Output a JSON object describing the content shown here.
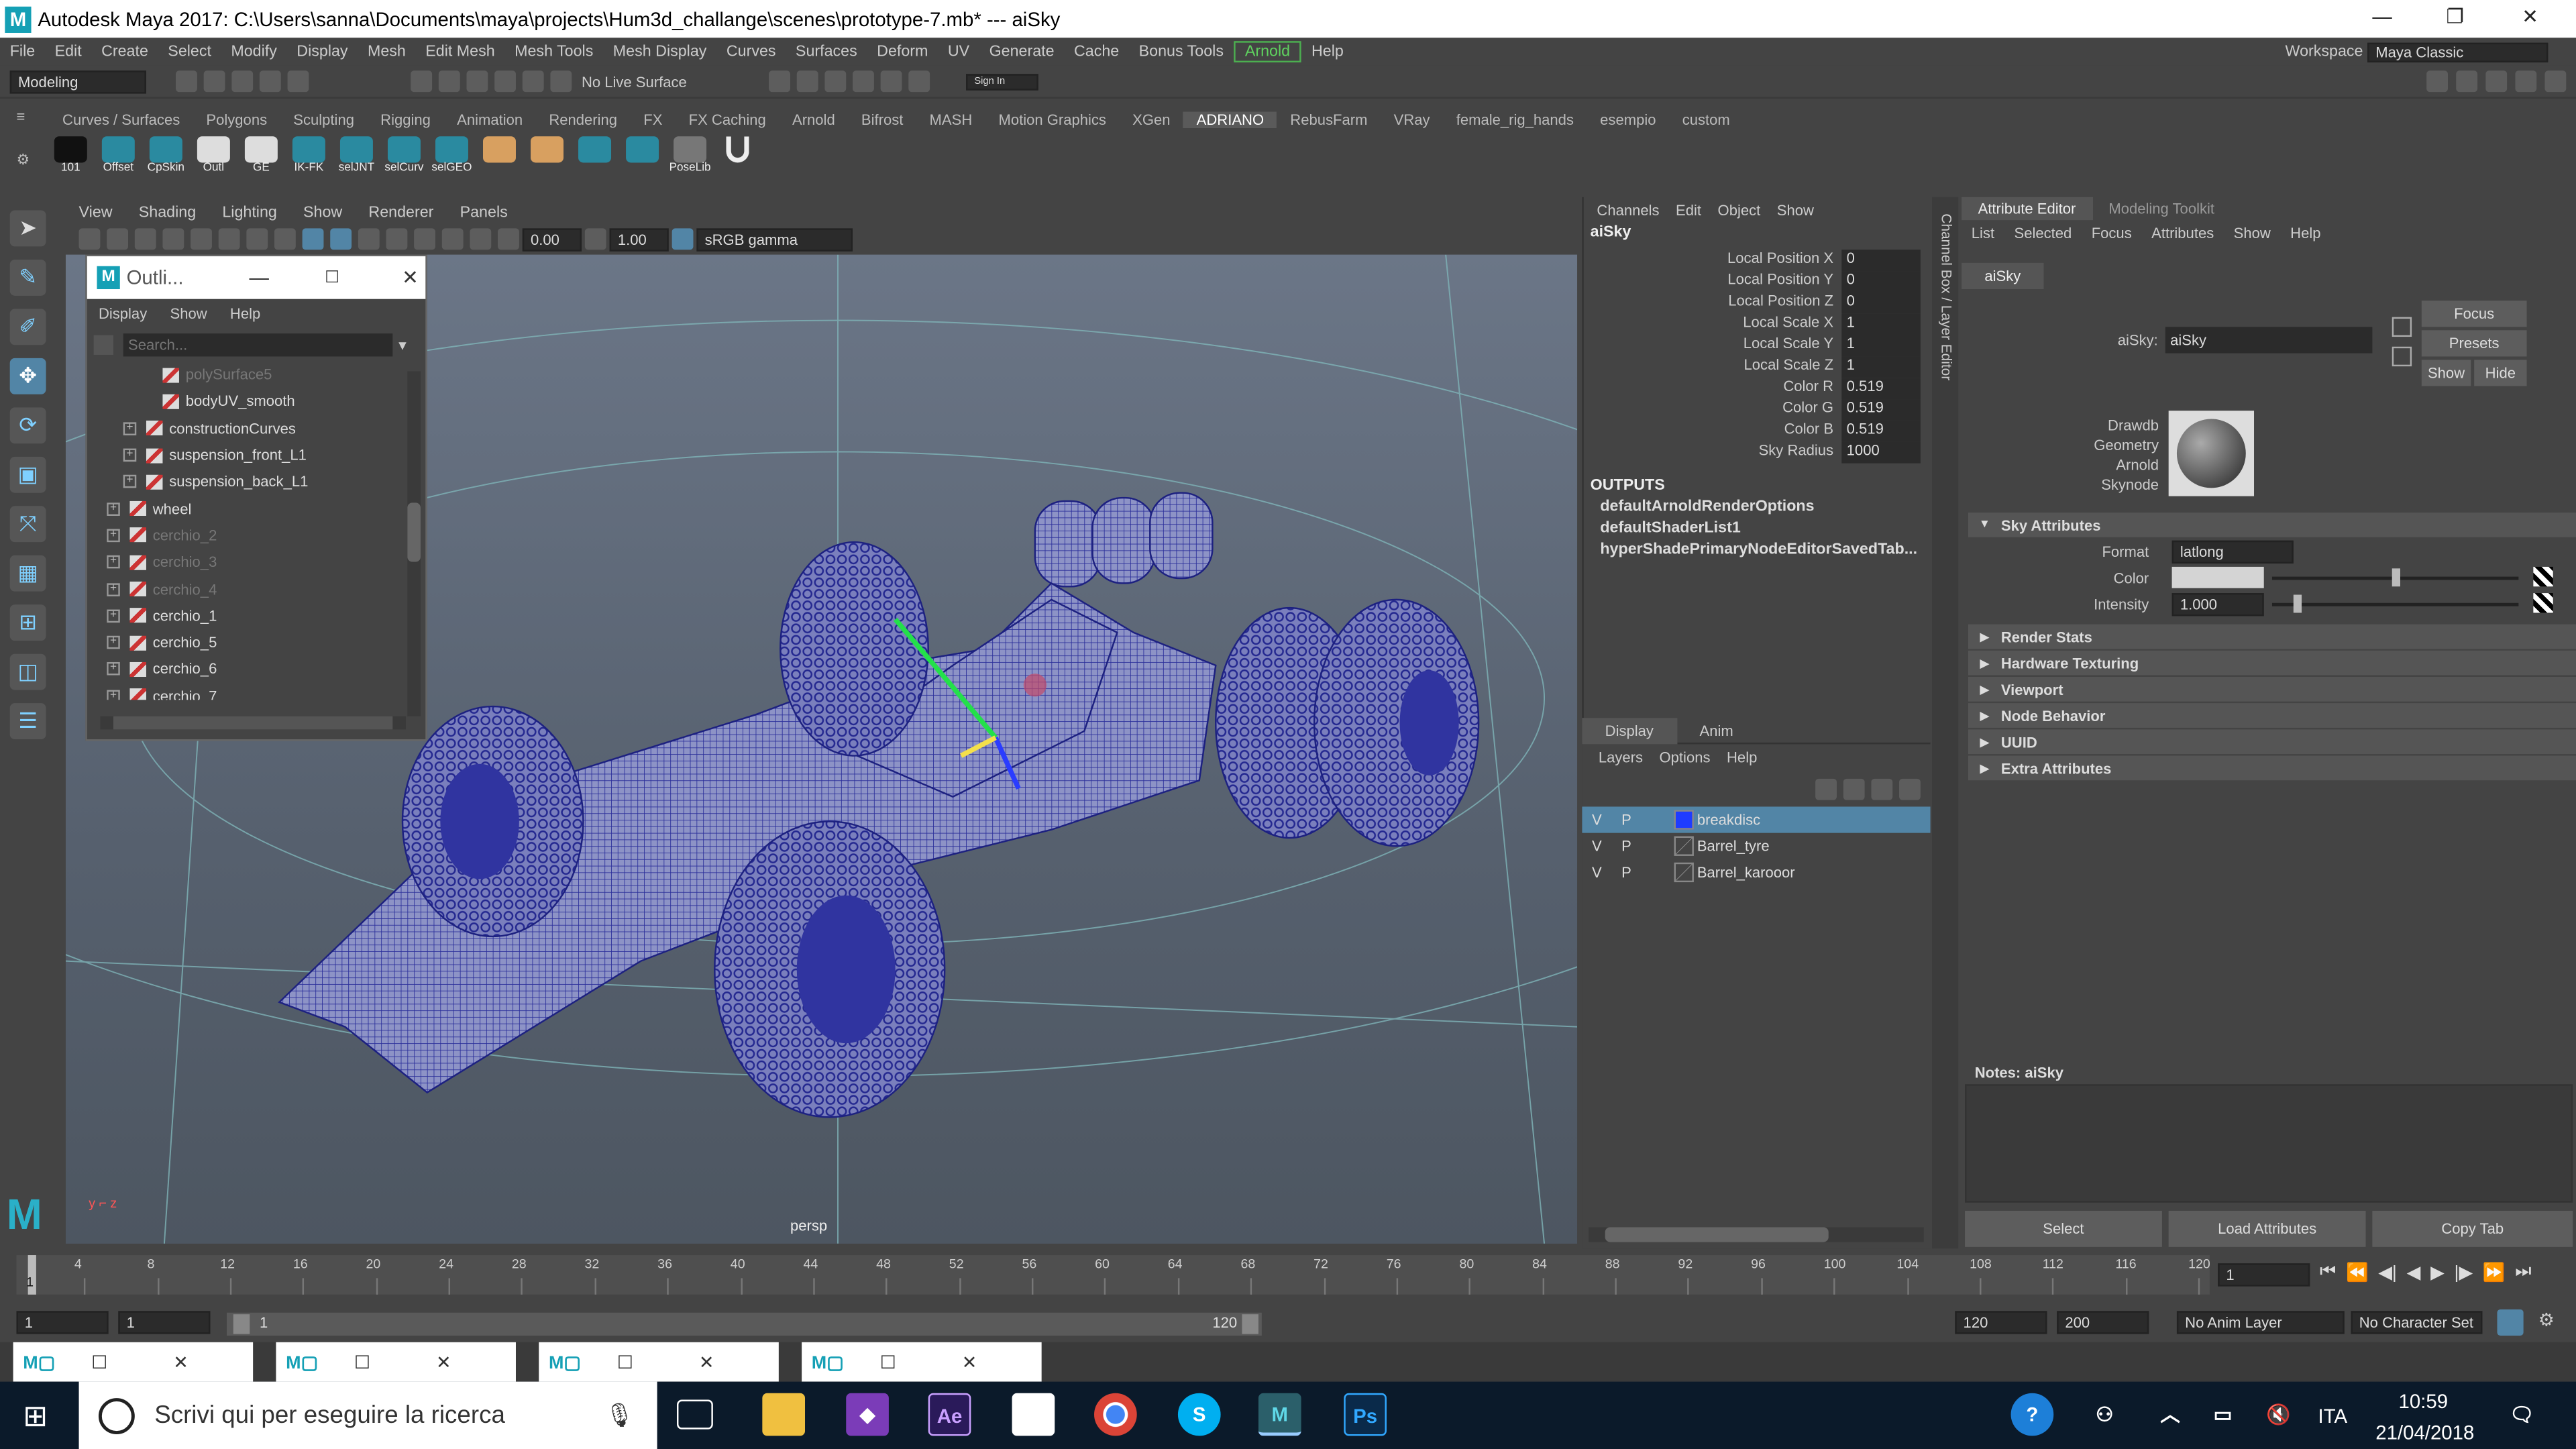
{
  "window": {
    "title": "Autodesk Maya 2017: C:\\Users\\sanna\\Documents\\maya\\projects\\Hum3d_challange\\scenes\\prototype-7.mb*   ---   aiSky",
    "minimize": "—",
    "maximize": "❐",
    "close": "✕"
  },
  "menus": [
    "File",
    "Edit",
    "Create",
    "Select",
    "Modify",
    "Display",
    "Mesh",
    "Edit Mesh",
    "Mesh Tools",
    "Mesh Display",
    "Curves",
    "Surfaces",
    "Deform",
    "UV",
    "Generate",
    "Cache",
    "Bonus Tools",
    "Arnold",
    "Help"
  ],
  "workspace": {
    "label": "Workspace :",
    "value": "Maya Classic"
  },
  "status": {
    "mode": "Modeling",
    "live": "No Live Surface",
    "signin": "Sign In"
  },
  "shelf_tabs": [
    "Curves / Surfaces",
    "Polygons",
    "Sculpting",
    "Rigging",
    "Animation",
    "Rendering",
    "FX",
    "FX Caching",
    "Arnold",
    "Bifrost",
    "MASH",
    "Motion Graphics",
    "XGen",
    "ADRIANO",
    "RebusFarm",
    "VRay",
    "female_rig_hands",
    "esempio",
    "custom"
  ],
  "shelf_active": "ADRIANO",
  "shelf_icons": [
    "101",
    "Offset",
    "CpSkin",
    "Outl",
    "GE",
    "IK-FK",
    "selJNT",
    "selCurv",
    "selGEO",
    "",
    "",
    "",
    "",
    "PoseLib",
    ""
  ],
  "view_menu": [
    "View",
    "Shading",
    "Lighting",
    "Show",
    "Renderer",
    "Panels"
  ],
  "view_fields": {
    "near": "0.00",
    "far": "1.00",
    "colorspace": "sRGB gamma"
  },
  "viewport": {
    "camera": "persp"
  },
  "outliner": {
    "title": "Outli...",
    "menus": [
      "Display",
      "Show",
      "Help"
    ],
    "search_placeholder": "Search...",
    "rows": [
      {
        "name": "polySurface5",
        "dim": true,
        "indent": 2,
        "expand": false
      },
      {
        "name": "bodyUV_smooth",
        "dim": false,
        "indent": 2,
        "expand": false
      },
      {
        "name": "constructionCurves",
        "dim": false,
        "indent": 1,
        "expand": true
      },
      {
        "name": "suspension_front_L1",
        "dim": false,
        "indent": 1,
        "expand": true
      },
      {
        "name": "suspension_back_L1",
        "dim": false,
        "indent": 1,
        "expand": true
      },
      {
        "name": "wheel",
        "dim": false,
        "indent": 0,
        "expand": true
      },
      {
        "name": "cerchio_2",
        "dim": true,
        "indent": 0,
        "expand": true
      },
      {
        "name": "cerchio_3",
        "dim": true,
        "indent": 0,
        "expand": true
      },
      {
        "name": "cerchio_4",
        "dim": true,
        "indent": 0,
        "expand": true
      },
      {
        "name": "cerchio_1",
        "dim": false,
        "indent": 0,
        "expand": true
      },
      {
        "name": "cerchio_5",
        "dim": false,
        "indent": 0,
        "expand": true
      },
      {
        "name": "cerchio_6",
        "dim": false,
        "indent": 0,
        "expand": true
      },
      {
        "name": "cerchio_7",
        "dim": false,
        "indent": 0,
        "expand": true
      }
    ]
  },
  "channel_box": {
    "menus": [
      "Channels",
      "Edit",
      "Object",
      "Show"
    ],
    "node": "aiSky",
    "channels": [
      {
        "label": "Local Position X",
        "value": "0"
      },
      {
        "label": "Local Position Y",
        "value": "0"
      },
      {
        "label": "Local Position Z",
        "value": "0"
      },
      {
        "label": "Local Scale X",
        "value": "1"
      },
      {
        "label": "Local Scale Y",
        "value": "1"
      },
      {
        "label": "Local Scale Z",
        "value": "1"
      },
      {
        "label": "Color R",
        "value": "0.519"
      },
      {
        "label": "Color G",
        "value": "0.519"
      },
      {
        "label": "Color B",
        "value": "0.519"
      },
      {
        "label": "Sky Radius",
        "value": "1000"
      }
    ],
    "outputs_label": "OUTPUTS",
    "outputs": [
      "defaultArnoldRenderOptions",
      "defaultShaderList1",
      "hyperShadePrimaryNodeEditorSavedTab..."
    ],
    "vertical_tab": "Channel Box / Layer Editor"
  },
  "layer_editor": {
    "tabs": [
      "Display",
      "Anim"
    ],
    "menus": [
      "Layers",
      "Options",
      "Help"
    ],
    "layers": [
      {
        "v": "V",
        "p": "P",
        "name": "breakdisc",
        "color": "#1f3cff",
        "selected": true
      },
      {
        "v": "V",
        "p": "P",
        "name": "Barrel_tyre",
        "color": "",
        "selected": false
      },
      {
        "v": "V",
        "p": "P",
        "name": "Barrel_karooor",
        "color": "",
        "selected": false
      }
    ]
  },
  "attr_editor": {
    "tabs": [
      "Attribute Editor",
      "Modeling Toolkit"
    ],
    "menus": [
      "List",
      "Selected",
      "Focus",
      "Attributes",
      "Show",
      "Help"
    ],
    "node_tab": "aiSky",
    "field_label": "aiSky:",
    "field_value": "aiSky",
    "buttons": {
      "focus": "Focus",
      "presets": "Presets",
      "show": "Show",
      "hide": "Hide"
    },
    "swatch_labels": [
      "Drawdb",
      "Geometry",
      "Arnold",
      "Skynode"
    ],
    "sections": [
      "Sky Attributes",
      "Render Stats",
      "Hardware Texturing",
      "Viewport",
      "Node Behavior",
      "UUID",
      "Extra Attributes"
    ],
    "format": {
      "label": "Format",
      "value": "latlong"
    },
    "color_label": "Color",
    "intensity": {
      "label": "Intensity",
      "value": "1.000"
    },
    "notes": "Notes:  aiSky",
    "bottom_buttons": [
      "Select",
      "Load Attributes",
      "Copy Tab"
    ]
  },
  "timeline": {
    "ticks": [
      "4",
      "8",
      "12",
      "16",
      "20",
      "24",
      "28",
      "32",
      "36",
      "40",
      "44",
      "48",
      "52",
      "56",
      "60",
      "64",
      "68",
      "72",
      "76",
      "80",
      "84",
      "88",
      "92",
      "96",
      "100",
      "104",
      "108",
      "112",
      "116",
      "120"
    ],
    "first": "1",
    "current": "1"
  },
  "range": {
    "start": "1",
    "start2": "1",
    "slider_start": "1",
    "slider_end": "120",
    "end": "120",
    "end2": "200",
    "anim_layer": "No Anim Layer",
    "char_set": "No Character Set"
  },
  "taskbar": {
    "search": "Scrivi qui per eseguire la ricerca",
    "lang": "ITA",
    "time": "10:59",
    "date": "21/04/2018"
  },
  "colors": {
    "accent": "#5285a6",
    "arnold": "#4caf50",
    "wire": "#2a2e9a"
  }
}
